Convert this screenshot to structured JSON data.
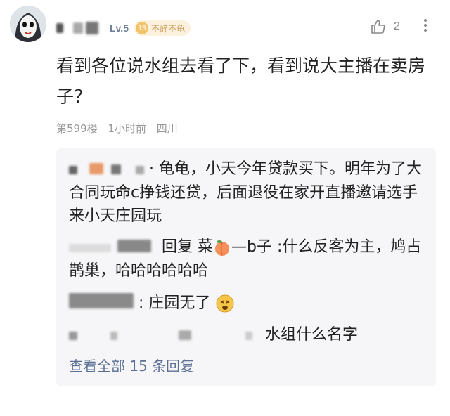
{
  "comment": {
    "level": "Lv.5",
    "badge": {
      "num": "13",
      "label": "不醉不龟"
    },
    "like_count": "2",
    "text": "看到各位说水组去看了下，看到说大主播在卖房子？",
    "meta": {
      "floor": "第599楼",
      "time": "1小时前",
      "location": "四川"
    }
  },
  "replies": {
    "items": [
      {
        "text": "· 龟龟，小天今年贷款买下。明年为了大合同玩命c挣钱还贷，后面退役在家开直播邀请选手来小天庄园玩"
      },
      {
        "reply_word": "回复",
        "mention_a": "菜",
        "mention_b": "—b子",
        "text": ":什么反客为主，鸠占鹊巢，哈哈哈哈哈哈"
      },
      {
        "text": ": 庄园无了"
      },
      {
        "text": "水组什么名字"
      }
    ],
    "view_all": "查看全部 15 条回复"
  }
}
